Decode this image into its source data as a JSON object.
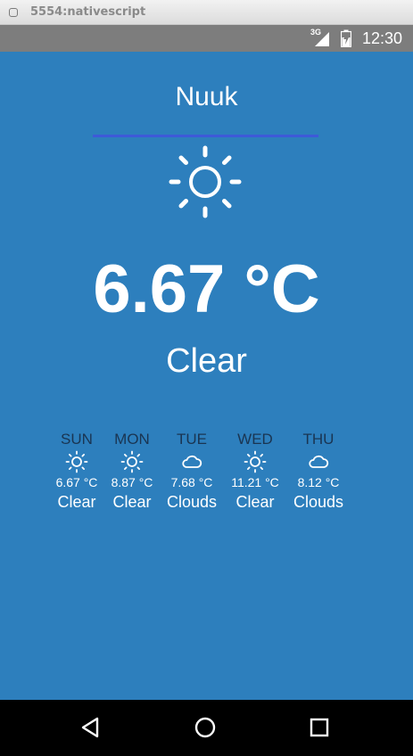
{
  "window": {
    "title": "5554:nativescript"
  },
  "status_bar": {
    "network": "3G",
    "time": "12:30"
  },
  "current": {
    "city": "Nuuk",
    "icon": "sun-icon",
    "temperature": "6.67 °C",
    "condition": "Clear"
  },
  "forecast": [
    {
      "day": "SUN",
      "icon": "sun-icon",
      "temp": "6.67 °C",
      "condition": "Clear"
    },
    {
      "day": "MON",
      "icon": "sun-icon",
      "temp": "8.87 °C",
      "condition": "Clear"
    },
    {
      "day": "TUE",
      "icon": "cloud-icon",
      "temp": "7.68 °C",
      "condition": "Clouds"
    },
    {
      "day": "WED",
      "icon": "sun-icon",
      "temp": "11.21 °C",
      "condition": "Clear"
    },
    {
      "day": "THU",
      "icon": "cloud-icon",
      "temp": "8.12 °C",
      "condition": "Clouds"
    }
  ],
  "colors": {
    "app_background": "#2d7fbd",
    "divider": "#3e5ad8",
    "day_label": "#1a3552",
    "status_bar": "#7d7d7d"
  },
  "nav_bar": {
    "buttons": [
      "back-icon",
      "home-icon",
      "recents-icon"
    ]
  }
}
